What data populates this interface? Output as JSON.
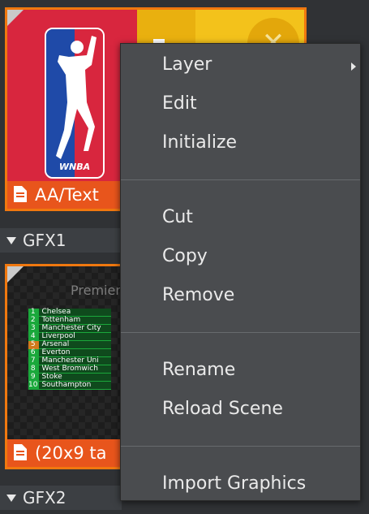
{
  "tiles": [
    {
      "label": "AA/Text",
      "thumbnail": "wnba-logo",
      "icon": "document-icon"
    },
    {
      "label": "(20x9 ta",
      "thumbnail": "premier-league-table",
      "icon": "document-icon",
      "table_title": "Premier",
      "rows": [
        {
          "pos": "1",
          "team": "Chelsea"
        },
        {
          "pos": "2",
          "team": "Tottenham"
        },
        {
          "pos": "3",
          "team": "Manchester City"
        },
        {
          "pos": "4",
          "team": "Liverpool"
        },
        {
          "pos": "5",
          "team": "Arsenal"
        },
        {
          "pos": "6",
          "team": "Everton"
        },
        {
          "pos": "7",
          "team": "Manchester Uni"
        },
        {
          "pos": "8",
          "team": "West Bromwich"
        },
        {
          "pos": "9",
          "team": "Stoke"
        },
        {
          "pos": "10",
          "team": "Southampton"
        }
      ]
    }
  ],
  "logo_text": "WNBA",
  "groups": [
    "GFX1",
    "GFX2"
  ],
  "context_menu": {
    "sections": [
      [
        "Layer",
        "Edit",
        "Initialize"
      ],
      [
        "Cut",
        "Copy",
        "Remove"
      ],
      [
        "Rename",
        "Reload Scene"
      ],
      [
        "Import Graphics"
      ]
    ]
  },
  "colors": {
    "tile_border": "#f0780f",
    "menu_bg": "#4a4c4f",
    "panel_bg": "#303235"
  }
}
